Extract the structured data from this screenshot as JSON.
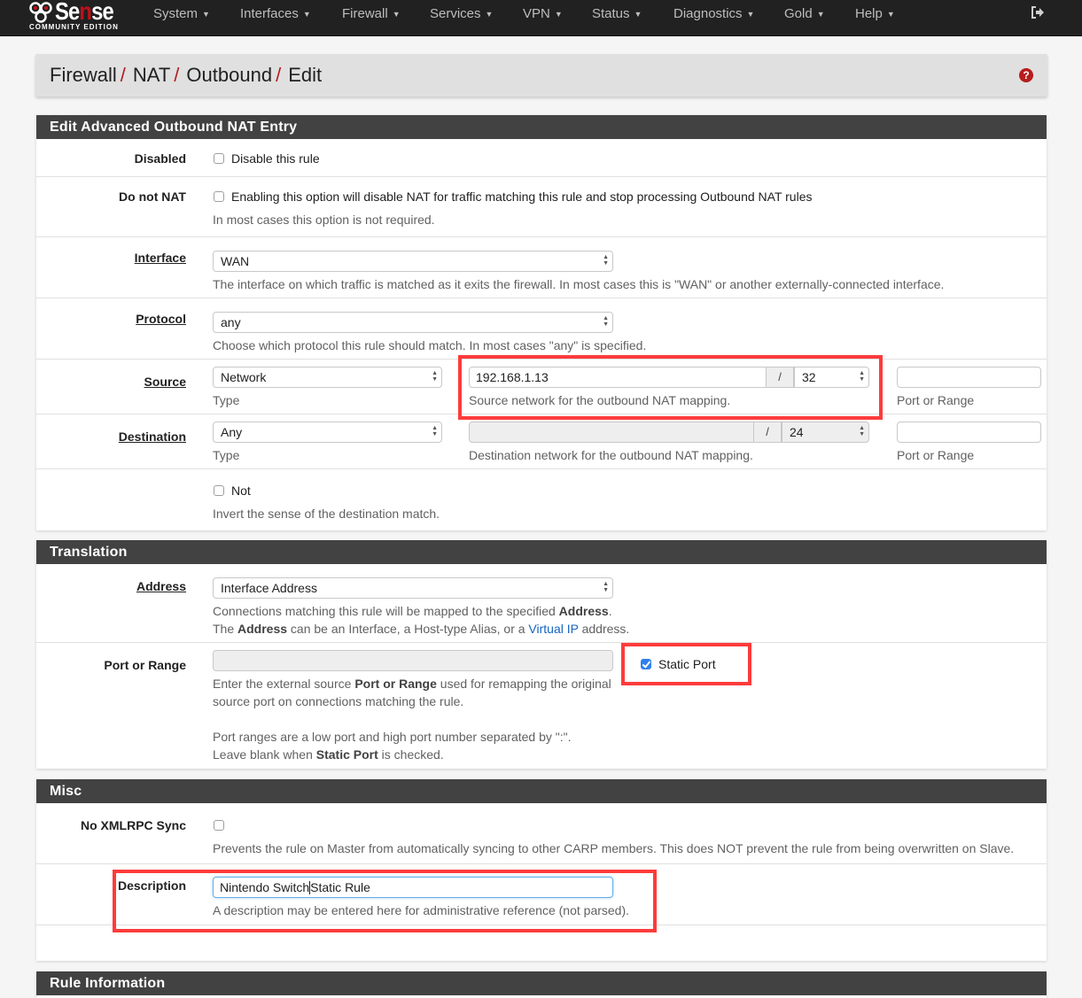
{
  "navbar": {
    "logo": {
      "word_pre": "Se",
      "word_red": "n",
      "word_post": "se",
      "subtitle": "COMMUNITY EDITION"
    },
    "items": [
      {
        "label": "System"
      },
      {
        "label": "Interfaces"
      },
      {
        "label": "Firewall"
      },
      {
        "label": "Services"
      },
      {
        "label": "VPN"
      },
      {
        "label": "Status"
      },
      {
        "label": "Diagnostics"
      },
      {
        "label": "Gold"
      },
      {
        "label": "Help"
      }
    ],
    "logout_icon": "sign-out-icon"
  },
  "breadcrumb": {
    "items": [
      "Firewall",
      "NAT",
      "Outbound",
      "Edit"
    ],
    "separator": "/",
    "help_icon": "question-circle-icon",
    "help_glyph": "?"
  },
  "sections": {
    "edit": {
      "title": "Edit Advanced Outbound NAT Entry",
      "disabled": {
        "label": "Disabled",
        "checkbox_label": "Disable this rule",
        "checked": false
      },
      "do_not_nat": {
        "label": "Do not NAT",
        "checkbox_label": "Enabling this option will disable NAT for traffic matching this rule and stop processing Outbound NAT rules",
        "checked": false,
        "help": "In most cases this option is not required."
      },
      "interface": {
        "label": "Interface",
        "value": "WAN",
        "help": "The interface on which traffic is matched as it exits the firewall. In most cases this is \"WAN\" or another externally-connected interface."
      },
      "protocol": {
        "label": "Protocol",
        "value": "any",
        "help": "Choose which protocol this rule should match. In most cases \"any\" is specified."
      },
      "source": {
        "label": "Source",
        "type": "Network",
        "type_help": "Type",
        "network": "192.168.1.13",
        "slash": "/",
        "mask": "32",
        "network_help": "Source network for the outbound NAT mapping.",
        "port": "",
        "port_help": "Port or Range"
      },
      "destination": {
        "label": "Destination",
        "type": "Any",
        "type_help": "Type",
        "network": "",
        "slash": "/",
        "mask": "24",
        "network_help": "Destination network for the outbound NAT mapping.",
        "port": "",
        "port_help": "Port or Range"
      },
      "not": {
        "checkbox_label": "Not",
        "checked": false,
        "help": "Invert the sense of the destination match."
      }
    },
    "translation": {
      "title": "Translation",
      "address": {
        "label": "Address",
        "value": "Interface Address",
        "help1_pre": "Connections matching this rule will be mapped to the specified ",
        "help1_bold": "Address",
        "help1_post": ".",
        "help2_pre": "The ",
        "help2_bold": "Address",
        "help2_mid": " can be an Interface, a Host-type Alias, or a ",
        "help2_link": "Virtual IP",
        "help2_post": " address."
      },
      "port": {
        "label": "Port or Range",
        "value": "",
        "static_port_label": "Static Port",
        "static_port_checked": true,
        "help1_pre": "Enter the external source ",
        "help1_bold": "Port or Range",
        "help1_post": " used for remapping the original",
        "help2": "source port on connections matching the rule.",
        "help3": "Port ranges are a low port and high port number separated by \":\".",
        "help4_pre": "Leave blank when ",
        "help4_bold": "Static Port",
        "help4_post": " is checked."
      }
    },
    "misc": {
      "title": "Misc",
      "no_xmlrpc": {
        "label": "No XMLRPC Sync",
        "checked": false,
        "help": "Prevents the rule on Master from automatically syncing to other CARP members. This does NOT prevent the rule from being overwritten on Slave."
      },
      "description": {
        "label": "Description",
        "value_before_cursor": "Nintendo Switch",
        "value_after_cursor": "Static Rule",
        "help": "A description may be entered here for administrative reference (not parsed)."
      }
    },
    "rule_information": {
      "title": "Rule Information"
    }
  },
  "highlight_color": "#ff3b3b"
}
